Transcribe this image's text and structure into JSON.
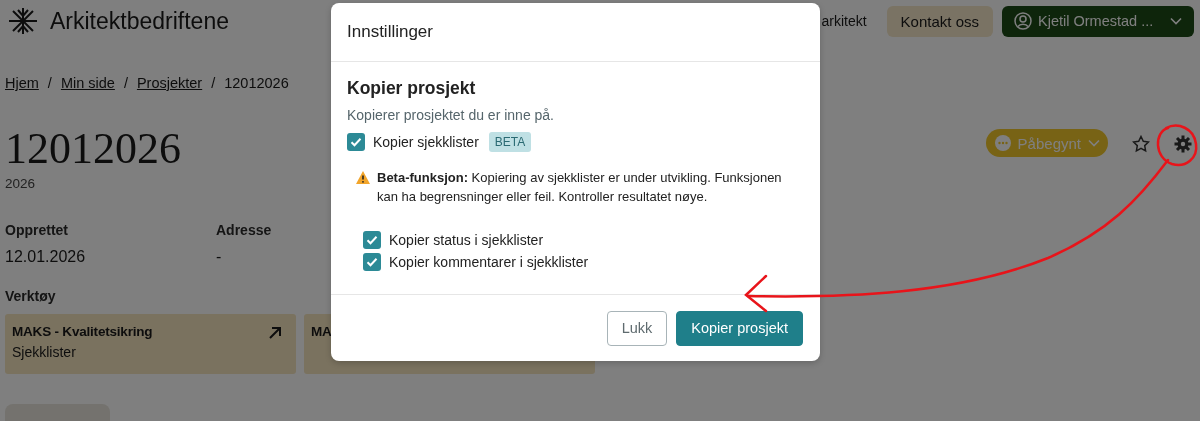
{
  "header": {
    "logo": "Arkitektbedriftene",
    "nav": [
      "arkitekt"
    ],
    "contact_button": "Kontakt oss",
    "user_menu": "Kjetil Ormestad ..."
  },
  "breadcrumb": [
    {
      "label": "Hjem",
      "kind": "link"
    },
    {
      "label": "/",
      "kind": "separator"
    },
    {
      "label": "Min side",
      "kind": "link"
    },
    {
      "label": "/",
      "kind": "separator"
    },
    {
      "label": "Prosjekter",
      "kind": "link"
    },
    {
      "label": "/",
      "kind": "separator"
    },
    {
      "label": "12012026",
      "kind": "current"
    }
  ],
  "project": {
    "title": "12012026",
    "subtitle": "2026",
    "status": "Påbegynt",
    "fields": [
      {
        "label": "Opprettet",
        "value": "12.01.2026"
      },
      {
        "label": "Adresse",
        "value": "-"
      }
    ]
  },
  "tools": {
    "heading": "Verktøy",
    "cards": [
      {
        "title": "MAKS - Kvalitetsikring",
        "subtitle": "Sjekklister",
        "external": true
      },
      {
        "title": "MA"
      }
    ]
  },
  "dialog": {
    "title": "Innstillinger",
    "section_title": "Kopier prosjekt",
    "description": "Kopierer prosjektet du er inne på.",
    "main_option": {
      "label": "Kopier sjekklister",
      "badge": "BETA",
      "checked": true
    },
    "warning": "**Beta-funksjon:** Kopiering av sjekklister er under utvikling. Funksjonen kan ha begrensninger eller feil. Kontroller resultatet nøye.",
    "sub_options": [
      {
        "label": "Kopier status i sjekklister",
        "checked": true
      },
      {
        "label": "Kopier kommentarer i sjekklister",
        "checked": true
      }
    ],
    "buttons": [
      {
        "label": "Lukk",
        "kind": "secondary"
      },
      {
        "label": "Kopier prosjekt",
        "kind": "primary"
      }
    ]
  }
}
